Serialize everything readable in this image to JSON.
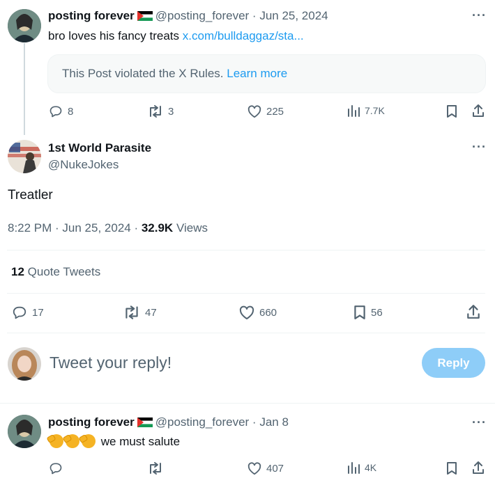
{
  "parent_tweet": {
    "display_name": "posting forever",
    "handle": "@posting_forever",
    "date": "Jun 25, 2024",
    "text": "bro loves his fancy treats",
    "link": "x.com/bulldaggaz/sta...",
    "notice_text": "This Post violated the X Rules.",
    "notice_link": "Learn more",
    "replies": "8",
    "retweets": "3",
    "likes": "225",
    "views": "7.7K"
  },
  "main_tweet": {
    "display_name": "1st World Parasite",
    "handle": "@NukeJokes",
    "text": "Treatler",
    "time": "8:22 PM",
    "date": "Jun 25, 2024",
    "views_count": "32.9K",
    "views_label": "Views",
    "quote_count": "12",
    "quote_label": "Quote Tweets",
    "replies": "17",
    "retweets": "47",
    "likes": "660",
    "bookmarks": "56"
  },
  "composer": {
    "placeholder": "Tweet your reply!",
    "button_label": "Reply"
  },
  "reply_tweet": {
    "display_name": "posting forever",
    "handle": "@posting_forever",
    "date": "Jan 8",
    "text": "we must salute",
    "likes": "407",
    "views": "4K"
  },
  "colors": {
    "accent": "#1d9bf0",
    "muted": "#536471",
    "reply_button": "#8ecdf8"
  },
  "icons": [
    "reply-icon",
    "retweet-icon",
    "like-icon",
    "views-icon",
    "bookmark-icon",
    "share-icon",
    "more-icon",
    "palestine-flag-icon",
    "saluting-face-icon"
  ]
}
